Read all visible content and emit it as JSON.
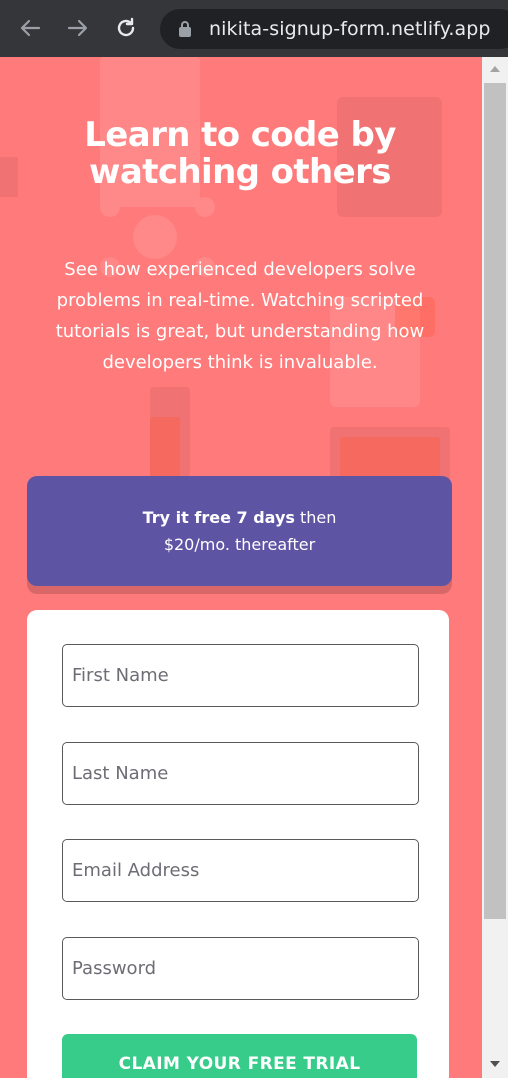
{
  "browser": {
    "url": "nikita-signup-form.netlify.app",
    "back_icon": "back-arrow-icon",
    "forward_icon": "forward-arrow-icon",
    "reload_icon": "reload-icon",
    "lock_icon": "lock-icon"
  },
  "hero": {
    "title": "Learn to code by watching others",
    "text": "See how experienced developers solve problems in real-time. Watching scripted tutorials is great, but understanding how developers think is invaluable."
  },
  "promo": {
    "bold": "Try it free 7 days",
    "rest1": " then",
    "rest2": "$20/mo. thereafter"
  },
  "form": {
    "first_name_placeholder": "First Name",
    "last_name_placeholder": "Last Name",
    "email_placeholder": "Email Address",
    "password_placeholder": "Password",
    "submit_label": "CLAIM YOUR FREE TRIAL"
  },
  "colors": {
    "background": "#ff7a7a",
    "promo": "#5e54a4",
    "cta": "#38cc8b"
  }
}
